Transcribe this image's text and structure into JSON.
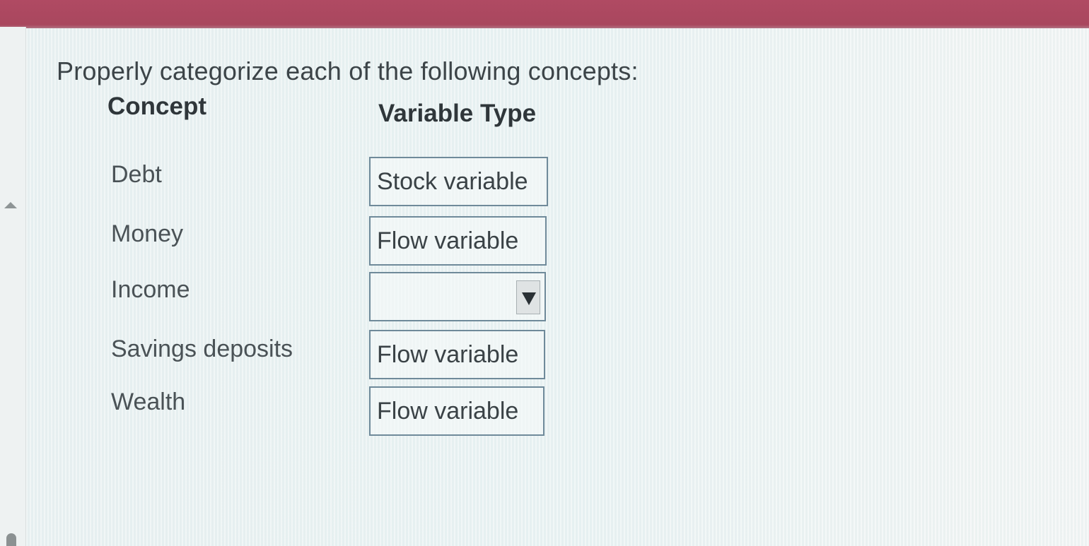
{
  "question": {
    "prompt": "Properly categorize each of the following concepts:"
  },
  "table": {
    "headers": {
      "concept": "Concept",
      "variable_type": "Variable Type"
    },
    "rows": [
      {
        "concept": "Debt",
        "selected": "Stock variable"
      },
      {
        "concept": "Money",
        "selected": "Flow variable"
      },
      {
        "concept": "Income",
        "selected": ""
      },
      {
        "concept": "Savings deposits",
        "selected": "Flow variable"
      },
      {
        "concept": "Wealth",
        "selected": "Flow variable"
      }
    ]
  },
  "icons": {
    "dropdown": "triangle-down-icon",
    "scroll_up": "triangle-up-icon"
  },
  "colors": {
    "top_bar": "#a9475e",
    "select_border": "#6f8a9a"
  }
}
